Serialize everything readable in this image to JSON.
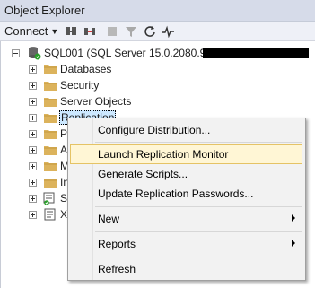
{
  "window": {
    "title": "Object Explorer"
  },
  "toolbar": {
    "connect_label": "Connect",
    "icons": [
      "connect-dropdown-icon",
      "connect-server-icon",
      "disconnect-icon",
      "stop-icon",
      "filter-icon",
      "refresh-icon",
      "activity-monitor-icon"
    ]
  },
  "tree": {
    "server_label": "SQL001 (SQL Server 15.0.2080.9 -",
    "nodes": [
      {
        "label": "Databases"
      },
      {
        "label": "Security"
      },
      {
        "label": "Server Objects"
      },
      {
        "label": "Replication"
      },
      {
        "label": "P"
      },
      {
        "label": "A"
      },
      {
        "label": "M"
      },
      {
        "label": "In"
      },
      {
        "label": "S"
      },
      {
        "label": "X"
      }
    ]
  },
  "context_menu": {
    "items": [
      {
        "label": "Configure Distribution..."
      },
      {
        "label": "Launch Replication Monitor",
        "highlighted": true
      },
      {
        "label": "Generate Scripts..."
      },
      {
        "label": "Update Replication Passwords..."
      },
      {
        "label": "New",
        "submenu": true
      },
      {
        "label": "Reports",
        "submenu": true
      },
      {
        "label": "Refresh"
      }
    ]
  },
  "colors": {
    "title_bg": "#d6dbe9",
    "toolbar_bg": "#eef0f7",
    "folder": "#dcb35c",
    "highlight_bg": "#fff6d5",
    "highlight_border": "#e5c365"
  }
}
